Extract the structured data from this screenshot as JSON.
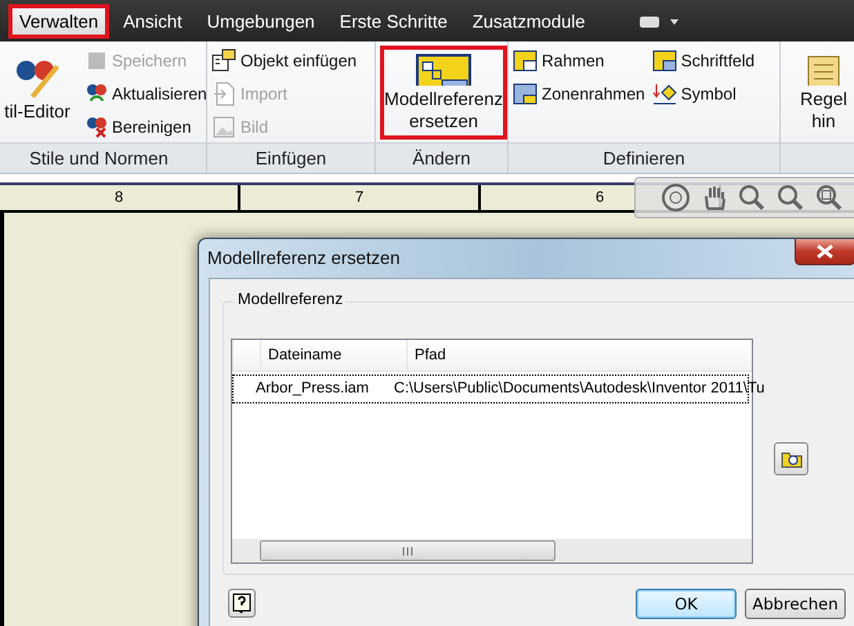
{
  "menu_tabs": [
    {
      "label": "Verwalten",
      "selected": true,
      "highlighted": true
    },
    {
      "label": "Ansicht",
      "selected": false,
      "highlighted": false
    },
    {
      "label": "Umgebungen",
      "selected": false,
      "highlighted": false
    },
    {
      "label": "Erste Schritte",
      "selected": false,
      "highlighted": false
    },
    {
      "label": "Zusatzmodule",
      "selected": false,
      "highlighted": false
    }
  ],
  "ribbon": {
    "groups": [
      {
        "title": "Stile und Normen",
        "columns": [
          [
            {
              "label": "til-Editor",
              "kind": "large",
              "highlighted": false
            }
          ],
          [
            {
              "label": "Speichern",
              "kind": "small",
              "disabled": true
            },
            {
              "label": "Aktualisieren",
              "kind": "small",
              "disabled": false
            },
            {
              "label": "Bereinigen",
              "kind": "small",
              "disabled": false
            }
          ]
        ]
      },
      {
        "title": "Einfügen",
        "columns": [
          [
            {
              "label": "Objekt einfügen",
              "kind": "small",
              "disabled": false
            },
            {
              "label": "Import",
              "kind": "small",
              "disabled": true
            },
            {
              "label": "Bild",
              "kind": "small",
              "disabled": true
            }
          ]
        ]
      },
      {
        "title": "Ändern",
        "columns": [
          [
            {
              "label": "Modellreferenz ersetzen",
              "kind": "large",
              "highlighted": true
            }
          ]
        ]
      },
      {
        "title": "Definieren",
        "columns": [
          [
            {
              "label": "Rahmen",
              "kind": "small",
              "disabled": false
            },
            {
              "label": "Zonenrahmen",
              "kind": "small",
              "disabled": false
            }
          ],
          [
            {
              "label": "Schriftfeld",
              "kind": "small",
              "disabled": false
            },
            {
              "label": "Symbol",
              "kind": "small",
              "disabled": false
            }
          ]
        ]
      },
      {
        "columns": [
          [
            {
              "label": "Regel hin",
              "kind": "large",
              "highlighted": false
            }
          ]
        ]
      }
    ]
  },
  "ruler": {
    "labels": [
      "8",
      "7",
      "6"
    ]
  },
  "dialog": {
    "title": "Modellreferenz ersetzen",
    "group_title": "Modellreferenz",
    "table": {
      "columns": [
        "Dateiname",
        "Pfad"
      ],
      "rows": [
        {
          "cells": [
            "Arbor_Press.iam",
            "C:\\Users\\Public\\Documents\\Autodesk\\Inventor 2011\\Tu"
          ],
          "selected": true
        }
      ]
    },
    "buttons": [
      {
        "label": "OK",
        "kind": "default"
      },
      {
        "label": "Abbrechen",
        "kind": "normal"
      }
    ]
  }
}
